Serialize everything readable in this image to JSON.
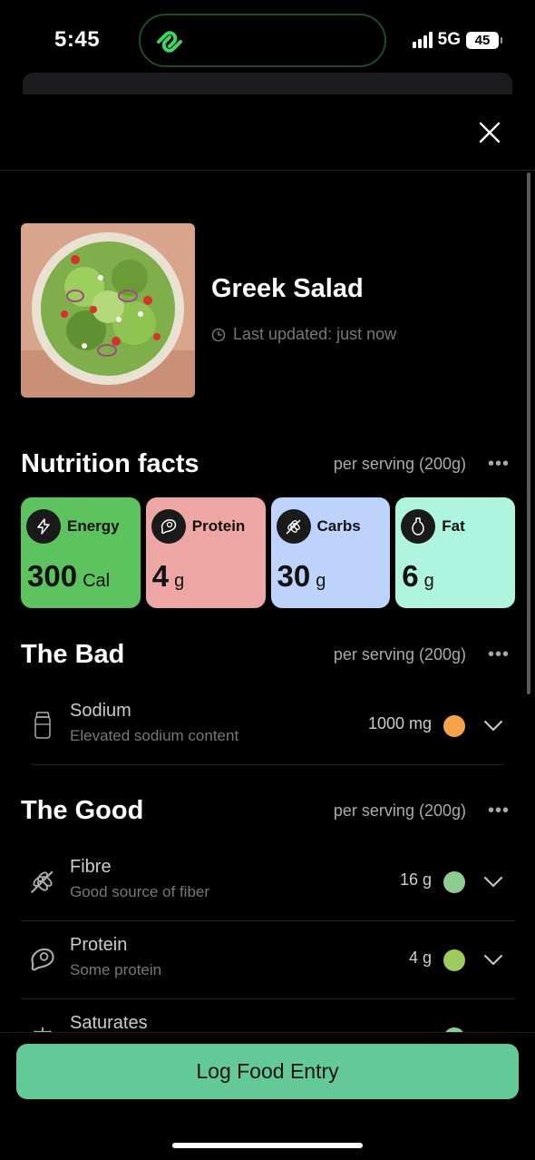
{
  "status": {
    "time": "5:45",
    "network": "5G",
    "battery": "45"
  },
  "food": {
    "title": "Greek Salad",
    "updated": "Last updated: just now"
  },
  "nutrition": {
    "title": "Nutrition facts",
    "serving": "per serving (200g)",
    "macros": [
      {
        "name": "Energy",
        "value": "300",
        "unit": "Cal",
        "color": "#5cc35f",
        "icon": "lightning-icon"
      },
      {
        "name": "Protein",
        "value": "4",
        "unit": "g",
        "color": "#eea6a5",
        "icon": "meat-icon"
      },
      {
        "name": "Carbs",
        "value": "30",
        "unit": "g",
        "color": "#bdd3fb",
        "icon": "wheat-icon"
      },
      {
        "name": "Fat",
        "value": "6",
        "unit": "g",
        "color": "#aef4df",
        "icon": "oil-bottle-icon"
      }
    ]
  },
  "bad": {
    "title": "The Bad",
    "serving": "per serving (200g)",
    "items": [
      {
        "name": "Sodium",
        "sub": "Elevated sodium content",
        "amount": "1000 mg",
        "color": "#f5a34a",
        "icon": "salt-shaker-icon"
      }
    ]
  },
  "good": {
    "title": "The Good",
    "serving": "per serving (200g)",
    "items": [
      {
        "name": "Fibre",
        "sub": "Good source of fiber",
        "amount": "16 g",
        "color": "#8fcc8f",
        "icon": "wheat-icon"
      },
      {
        "name": "Protein",
        "sub": "Some protein",
        "amount": "4 g",
        "color": "#9ccc5f",
        "icon": "meat-icon"
      },
      {
        "name": "Saturates",
        "sub": "",
        "amount": "",
        "color": "#8fcc8f",
        "icon": "scale-icon"
      }
    ]
  },
  "action": {
    "log_label": "Log Food Entry"
  }
}
